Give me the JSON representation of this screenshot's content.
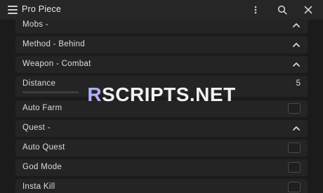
{
  "window": {
    "title": "Pro Piece",
    "icons": {
      "menu": "hamburger-menu-icon",
      "more": "more-vertical-icon",
      "search": "search-icon",
      "close": "close-icon"
    }
  },
  "rows": {
    "mobs": {
      "label": "Mobs -",
      "icon": "chevron-up-icon"
    },
    "method": {
      "label": "Method - Behind",
      "icon": "chevron-up-icon"
    },
    "weapon": {
      "label": "Weapon - Combat",
      "icon": "chevron-up-icon"
    },
    "distance": {
      "label": "Distance",
      "value": "5",
      "slider_fraction": 0.0
    },
    "auto_farm": {
      "label": "Auto Farm",
      "checked": false
    },
    "quest": {
      "label": "Quest -",
      "icon": "chevron-up-icon"
    },
    "auto_quest": {
      "label": "Auto Quest",
      "checked": false
    },
    "god_mode": {
      "label": "God Mode",
      "checked": false
    },
    "insta_kill": {
      "label": "Insta Kill",
      "checked": false
    }
  },
  "watermark": {
    "first": "R",
    "rest": "SCRIPTS.NET"
  },
  "colors": {
    "background": "#1b1b1b",
    "titlebar": "#262626",
    "row": "#242424",
    "text": "#dedede"
  }
}
